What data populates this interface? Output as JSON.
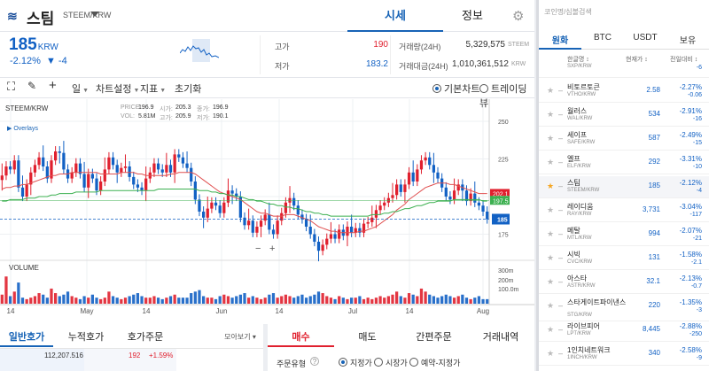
{
  "header": {
    "coin_name": "스팀",
    "pair": "STEEM/KRW",
    "tabs": [
      "시세",
      "정보"
    ]
  },
  "price": {
    "value": "185",
    "unit": "KRW",
    "change_pct": "-2.12%",
    "change_abs": "▼ -4"
  },
  "stats": {
    "high_label": "고가",
    "high_value": "190",
    "low_label": "저가",
    "low_value": "183.2",
    "vol_label": "거래량(24H)",
    "vol_value": "5,329,575",
    "vol_unit": "STEEM",
    "amt_label": "거래대금(24H)",
    "amt_value": "1,010,361,512",
    "amt_unit": "KRW"
  },
  "toolbar": {
    "interval": "일",
    "chart_settings": "차트설정",
    "indicator": "지표",
    "reset": "초기화",
    "basic_chart": "기본차트",
    "trading_view": "트레이딩뷰"
  },
  "chart": {
    "pair_label": "STEEM/KRW",
    "ohlc_labels": [
      "PRICE:",
      "시가:",
      "종가:",
      "VOL:",
      "고가:",
      "저가:"
    ],
    "ohlc_values": [
      "196.9",
      "205.3",
      "196.9",
      "5.81M",
      "205.9",
      "190.1"
    ],
    "overlays_label": "Overlays",
    "volume_label": "VOLUME",
    "y_ticks": [
      "250",
      "225",
      "200",
      "175"
    ],
    "vol_ticks": [
      "300m",
      "200m",
      "100.0m"
    ],
    "x_ticks": [
      "14",
      "May",
      "14",
      "Jun",
      "14",
      "Jul",
      "14",
      "Aug"
    ],
    "tag_red": "202.1",
    "tag_green": "197.5",
    "tag_blue": "185",
    "zoom_minus": "−",
    "zoom_plus": "+"
  },
  "bottom": {
    "tabs_left": [
      "일반호가",
      "누적호가",
      "호가주문",
      "모아보기"
    ],
    "ob_volume": "112,207.516",
    "ob_price": "192",
    "ob_pct": "+1.59%",
    "tabs_right": [
      "매수",
      "매도",
      "간편주문",
      "거래내역"
    ],
    "order_type_label": "주문유형",
    "order_options": [
      "지정가",
      "시장가",
      "예약-지정가"
    ]
  },
  "market": {
    "search_placeholder": "코인명/심볼검색",
    "tabs": [
      "원화",
      "BTC",
      "USDT",
      "보유"
    ],
    "col_name": "한글명 ↕",
    "col_price": "현재가 ↕",
    "col_change": "전일대비 ↕",
    "rows": [
      {
        "name": "",
        "pair": "SXP/KRW",
        "price": "",
        "pct": "",
        "chg": "-6"
      },
      {
        "name": "비토르토큰",
        "pair": "VTHO/KRW",
        "price": "2.58",
        "pct": "-2.27%",
        "chg": "-0.06"
      },
      {
        "name": "월러스",
        "pair": "WAL/KRW",
        "price": "534",
        "pct": "-2.91%",
        "chg": "-16"
      },
      {
        "name": "세이프",
        "pair": "SAFE/KRW",
        "price": "587",
        "pct": "-2.49%",
        "chg": "-15"
      },
      {
        "name": "엘프",
        "pair": "ELF/KRW",
        "price": "292",
        "pct": "-3.31%",
        "chg": "-10"
      },
      {
        "name": "스팀",
        "pair": "STEEM/KRW",
        "price": "185",
        "pct": "-2.12%",
        "chg": "-4"
      },
      {
        "name": "레이디움",
        "pair": "RAY/KRW",
        "price": "3,731",
        "pct": "-3.04%",
        "chg": "-117"
      },
      {
        "name": "메탈",
        "pair": "MTL/KRW",
        "price": "994",
        "pct": "-2.07%",
        "chg": "-21"
      },
      {
        "name": "시빅",
        "pair": "CVC/KRW",
        "price": "131",
        "pct": "-1.58%",
        "chg": "-2.1"
      },
      {
        "name": "아스타",
        "pair": "ASTR/KRW",
        "price": "32.1",
        "pct": "-2.13%",
        "chg": "-0.7"
      },
      {
        "name": "스타게이트파이낸스",
        "pair": "STG/KRW",
        "price": "220",
        "pct": "-1.35%",
        "chg": "-3"
      },
      {
        "name": "라이브피어",
        "pair": "LPT/KRW",
        "price": "8,445",
        "pct": "-2.88%",
        "chg": "-250"
      },
      {
        "name": "1인치네트워크",
        "pair": "1INCH/KRW",
        "price": "340",
        "pct": "-2.58%",
        "chg": "-9"
      }
    ]
  },
  "colors": {
    "accent": "#1763b6",
    "up": "#e0202e",
    "down": "#1261c4",
    "ma_red": "#e05050",
    "ma_green": "#3cb050"
  },
  "chart_data": {
    "type": "candlestick",
    "x_tick_labels": [
      "14",
      "May",
      "14",
      "Jun",
      "14",
      "Jul",
      "14",
      "Aug"
    ],
    "y_range": [
      160,
      260
    ],
    "closes": [
      214,
      220,
      218,
      224,
      206,
      200,
      208,
      216,
      221,
      226,
      220,
      212,
      224,
      230,
      229,
      218,
      212,
      216,
      222,
      215,
      206,
      215,
      212,
      204,
      210,
      218,
      226,
      221,
      216,
      219,
      220,
      213,
      208,
      206,
      204,
      212,
      216,
      222,
      218,
      216,
      221,
      216,
      228,
      226,
      222,
      219,
      210,
      198,
      190,
      186,
      192,
      196,
      194,
      189,
      196,
      204,
      202,
      200,
      186,
      181,
      184,
      176,
      180,
      184,
      188,
      178,
      175,
      184,
      189,
      196,
      199,
      194,
      188,
      185,
      180,
      175,
      170,
      164,
      168,
      172,
      175,
      172,
      178,
      174,
      180,
      176,
      179,
      176,
      182,
      183,
      186,
      191,
      194,
      196,
      199,
      201,
      208,
      203,
      208,
      216,
      210,
      218,
      224,
      226,
      221,
      216,
      212,
      206,
      200,
      198,
      204,
      208,
      204,
      197,
      202,
      196,
      194,
      190,
      185
    ],
    "ma_red": [
      205,
      206,
      206,
      207,
      207,
      208,
      208,
      209,
      210,
      211,
      212,
      213,
      214,
      214,
      215,
      215,
      215,
      216,
      216,
      216,
      216,
      216,
      216,
      216,
      215,
      215,
      215,
      215,
      215,
      216,
      216,
      216,
      216,
      215,
      215,
      214,
      214,
      214,
      214,
      214,
      214,
      215,
      215,
      216,
      216,
      216,
      216,
      215,
      213,
      211,
      209,
      207,
      205,
      203,
      202,
      201,
      200,
      199,
      198,
      196,
      194,
      192,
      190,
      189,
      189,
      188,
      187,
      187,
      187,
      188,
      188,
      188,
      187,
      186,
      185,
      184,
      182,
      180,
      179,
      178,
      177,
      177,
      176,
      176,
      176,
      176,
      176,
      177,
      177,
      178,
      179,
      180,
      182,
      184,
      186,
      188,
      191,
      193,
      195,
      198,
      200,
      202,
      204,
      206,
      207,
      208,
      209,
      209,
      209,
      208,
      208,
      207,
      206,
      205,
      204,
      203,
      202,
      202,
      202
    ],
    "ma_green": [
      197,
      197,
      198,
      198,
      198,
      198,
      199,
      199,
      199,
      200,
      200,
      200,
      201,
      201,
      202,
      202,
      202,
      202,
      203,
      203,
      203,
      203,
      203,
      203,
      204,
      204,
      204,
      204,
      204,
      204,
      204,
      204,
      204,
      204,
      204,
      204,
      204,
      204,
      205,
      205,
      205,
      205,
      205,
      205,
      205,
      205,
      205,
      205,
      204,
      204,
      204,
      203,
      203,
      202,
      202,
      201,
      201,
      200,
      200,
      199,
      198,
      198,
      197,
      197,
      196,
      195,
      195,
      194,
      194,
      193,
      193,
      192,
      192,
      191,
      190,
      190,
      189,
      189,
      188,
      188,
      187,
      187,
      187,
      187,
      187,
      187,
      187,
      187,
      187,
      187,
      188,
      188,
      188,
      189,
      189,
      190,
      190,
      191,
      192,
      192,
      193,
      194,
      194,
      195,
      196,
      196,
      197,
      197,
      197,
      197,
      198,
      198,
      198,
      198,
      198,
      198,
      198,
      197,
      197
    ],
    "volume_ticks": [
      "300m",
      "200m",
      "100.0m"
    ],
    "volumes": [
      30,
      90,
      25,
      40,
      70,
      20,
      15,
      20,
      25,
      35,
      30,
      20,
      50,
      35,
      25,
      30,
      40,
      25,
      20,
      15,
      25,
      20,
      30,
      20,
      15,
      20,
      40,
      25,
      20,
      15,
      20,
      25,
      30,
      35,
      25,
      20,
      20,
      25,
      20,
      15,
      20,
      25,
      30,
      20,
      20,
      20,
      35,
      40,
      45,
      25,
      20,
      20,
      15,
      25,
      30,
      25,
      20,
      25,
      30,
      35,
      20,
      25,
      20,
      15,
      20,
      30,
      35,
      20,
      25,
      30,
      25,
      20,
      25,
      30,
      20,
      25,
      30,
      40,
      35,
      25,
      20,
      15,
      25,
      20,
      15,
      20,
      20,
      25,
      15,
      20,
      15,
      20,
      25,
      20,
      25,
      30,
      40,
      25,
      20,
      35,
      30,
      25,
      50,
      40,
      30,
      25,
      20,
      25,
      30,
      25,
      20,
      25,
      30,
      20,
      15,
      20,
      25,
      15,
      15
    ]
  }
}
